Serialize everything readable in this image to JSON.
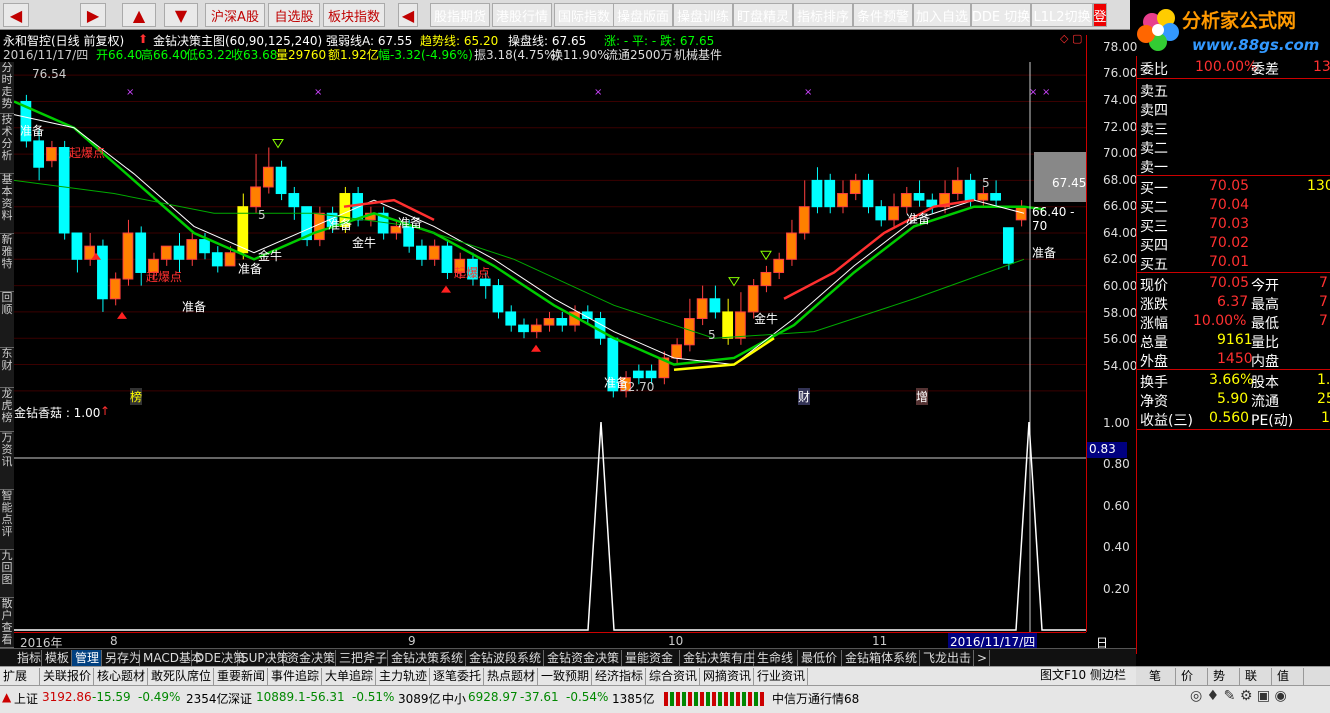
{
  "toolbar": {
    "nav_buttons": [
      "◀",
      "▶",
      "▲",
      "▼"
    ],
    "markets": [
      "沪深A股",
      "自选股",
      "板块指数"
    ],
    "nav_left": "◀",
    "buttons": [
      "股指期货",
      "港股行情",
      "国际指数",
      "操盘版面",
      "操盘训练",
      "盯盘精灵",
      "指标排序",
      "条件预警",
      "加入自选",
      "DDE 切换",
      "L1L2切换",
      "登"
    ]
  },
  "logo": {
    "text": "分析家公式网",
    "url_text": "www.88gs.com"
  },
  "stock": {
    "name": "永和智控(日线 前复权)",
    "indicator_title": "金钻决策主图(60,90,125,240)",
    "strong_weak": "强弱线A: 67.55",
    "trend_line": "趋势线: 65.20",
    "op_line": "操盘线: 67.65",
    "up_down": "涨: -  平: -  跌: 67.65",
    "date_line": "2016/11/17/四",
    "open": "开66.40",
    "high": "高66.40",
    "low": "低63.22",
    "close": "收63.68",
    "vol": "量29760",
    "amount": "额1.92亿",
    "change": "幅-3.32(-4.96%)",
    "amplitude": "振3.18(4.75%)",
    "turnover": "换11.90%",
    "float": "流通2500万",
    "sector": "机械基件"
  },
  "lefttabs": [
    "分时走势",
    "技术分析",
    "基本资料",
    "新雅特",
    "回顺",
    "东财",
    "龙虎榜",
    "万资讯",
    "智能点评",
    "九回图",
    "散户查看"
  ],
  "main_axis": [
    "78.00",
    "76.00",
    "74.00",
    "72.00",
    "70.00",
    "68.00",
    "66.00",
    "64.00",
    "62.00",
    "60.00",
    "58.00",
    "56.00",
    "54.00"
  ],
  "sub_axis": [
    "1.00",
    "0.80",
    "0.60",
    "0.40",
    "0.20"
  ],
  "sub_cursor_value": "0.83",
  "chart_labels": {
    "high_label": "76.54",
    "low_label": "52.70",
    "price_tag_1": "67.45",
    "price_tag_2": "66.40 - 70",
    "marker_a": "榜",
    "marker_b": "财",
    "marker_c": "增",
    "notes": [
      "准备",
      "起爆点",
      "起爆点",
      "准备",
      "金牛",
      "准备",
      "准备",
      "金牛",
      "准备",
      "起爆点",
      "准备",
      "金牛",
      "准备",
      "准备",
      "5",
      "5",
      "5"
    ]
  },
  "subchart": {
    "title": "金钻香菇 : 1.00"
  },
  "xaxis": {
    "labels": [
      "2016年",
      "8",
      "9",
      "10",
      "11",
      "2016/11/17/四"
    ],
    "right": "日线"
  },
  "quote": {
    "weibi_label": "委比",
    "weibi": "100.00%",
    "weicha_label": "委差",
    "weicha": "13",
    "sells": [
      "卖五",
      "卖四",
      "卖三",
      "卖二",
      "卖一"
    ],
    "buys": [
      {
        "label": "买一",
        "price": "70.05",
        "vol": "130"
      },
      {
        "label": "买二",
        "price": "70.04",
        "vol": ""
      },
      {
        "label": "买三",
        "price": "70.03",
        "vol": ""
      },
      {
        "label": "买四",
        "price": "70.02",
        "vol": ""
      },
      {
        "label": "买五",
        "price": "70.01",
        "vol": ""
      }
    ],
    "rows": [
      {
        "l1": "现价",
        "v1": "70.05",
        "l2": "今开",
        "v2": "7"
      },
      {
        "l1": "涨跌",
        "v1": "6.37",
        "l2": "最高",
        "v2": "7"
      },
      {
        "l1": "涨幅",
        "v1": "10.00%",
        "l2": "最低",
        "v2": "7"
      },
      {
        "l1": "总量",
        "v1": "9161",
        "l2": "量比",
        "v2": ""
      },
      {
        "l1": "外盘",
        "v1": "1450",
        "l2": "内盘",
        "v2": ""
      }
    ],
    "rows2": [
      {
        "l1": "换手",
        "v1": "3.66%",
        "l2": "股本",
        "v2": "1."
      },
      {
        "l1": "净资",
        "v1": "5.90",
        "l2": "流通",
        "v2": "25"
      },
      {
        "l1": "收益(三)",
        "v1": "0.560",
        "l2": "PE(动)",
        "v2": "1"
      }
    ]
  },
  "tabs1": [
    "指标",
    "模板",
    "管理",
    "另存为",
    "MACD基本",
    "DDE决策",
    "SUP决策",
    "资金决策",
    "三把斧子",
    "金钻决策系统",
    "金钻波段系统",
    "金钻资金决策",
    "量能资金",
    "金钻决策有庄",
    "生命线",
    "最低价",
    "金钻箱体系统",
    "飞龙出击",
    ">"
  ],
  "tabs2": [
    "扩展",
    "关联报价",
    "核心题材",
    "敢死队席位",
    "重要新闻",
    "事件追踪",
    "大单追踪",
    "主力轨迹",
    "逐笔委托",
    "热点题材",
    "一致预期",
    "经济指标",
    "综合资讯",
    "网摘资讯",
    "行业资讯"
  ],
  "tabs2_right": [
    "图文F10",
    "侧边栏"
  ],
  "quote_tabs": [
    "笔",
    "价",
    "势",
    "联",
    "值"
  ],
  "status": {
    "sh_name": "上证",
    "sh_val": "3192.86",
    "sh_chg": "-15.59",
    "sh_pct": "-0.49%",
    "sh_amt": "2354亿",
    "sz_name": "深证",
    "sz_val": "10889.1",
    "sz_chg": "-56.31",
    "sz_pct": "-0.51%",
    "sz_amt": "3089亿",
    "zx_name": "中小",
    "zx_val": "6928.97",
    "zx_chg": "-37.61",
    "zx_pct": "-0.54%",
    "zx_amt": "1385亿",
    "broker": "中信万通行情68"
  },
  "colors": {
    "up": "#ff2020",
    "down": "#00ffff",
    "accent": "#ffff00",
    "green_line": "#00cc00",
    "white_line": "#ffffff"
  }
}
